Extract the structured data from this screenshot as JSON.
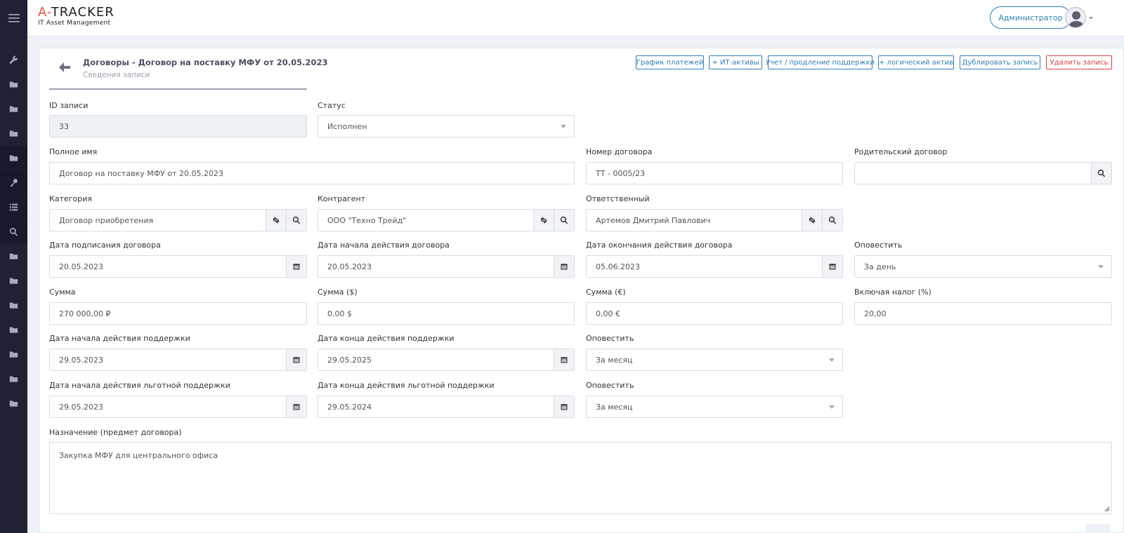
{
  "app": {
    "logo_main_prefix": "A-",
    "logo_main_rest": "TRACKER",
    "logo_sub": "IT Asset Management",
    "user_button": "Администратор"
  },
  "sidebar": {
    "items": [
      "menu-icon",
      "wrench-icon",
      "folder-icon",
      "folder-icon",
      "folder-icon",
      "folder-icon",
      "key-icon",
      "list-icon",
      "search-icon",
      "folder-icon",
      "folder-icon",
      "folder-icon",
      "folder-icon",
      "folder-icon",
      "folder-icon",
      "folder-icon"
    ]
  },
  "record": {
    "title": "Договоры - Договор на поставку МФУ от 20.05.2023",
    "subtitle": "Сведения записи"
  },
  "toolbar": {
    "payments": "График платежей",
    "it_assets": "+ ИТ-активы",
    "support": "Учет / продление поддержки",
    "logical_asset": "+ логический актив",
    "duplicate": "Дублировать запись",
    "delete": "Удалить запись"
  },
  "form": {
    "record_id": {
      "label": "ID записи",
      "value": "33"
    },
    "status": {
      "label": "Статус",
      "value": "Исполнен"
    },
    "full_name": {
      "label": "Полное имя",
      "value": "Договор на поставку МФУ от 20.05.2023"
    },
    "contract_number": {
      "label": "Номер договора",
      "value": "ТТ - 0005/23"
    },
    "parent_contract": {
      "label": "Родительский договор",
      "value": ""
    },
    "category": {
      "label": "Категория",
      "value": "Договор приобретения"
    },
    "counterparty": {
      "label": "Контрагент",
      "value": "ООО \"Техно Трейд\""
    },
    "responsible": {
      "label": "Ответственный",
      "value": "Артемов Дмитрий Павлович"
    },
    "sign_date": {
      "label": "Дата подписания договора",
      "value": "20.05.2023"
    },
    "start_date": {
      "label": "Дата начала действия договора",
      "value": "20.05.2023"
    },
    "end_date": {
      "label": "Дата окончания действия договора",
      "value": "05.06.2023"
    },
    "notify_1": {
      "label": "Оповестить",
      "value": "За день"
    },
    "sum_rub": {
      "label": "Сумма",
      "value": "270 000,00 ₽"
    },
    "sum_usd": {
      "label": "Сумма ($)",
      "value": "0,00 $"
    },
    "sum_eur": {
      "label": "Сумма (€)",
      "value": "0,00 €"
    },
    "tax": {
      "label": "Включая налог (%)",
      "value": "20,00"
    },
    "support_start": {
      "label": "Дата начала действия поддержки",
      "value": "29.05.2023"
    },
    "support_end": {
      "label": "Дата конца действия поддержки",
      "value": "29.05.2025"
    },
    "notify_2": {
      "label": "Оповестить",
      "value": "За месяц"
    },
    "grace_start": {
      "label": "Дата начала действия льготной поддержки",
      "value": "29.05.2023"
    },
    "grace_end": {
      "label": "Дата конца действия льготной поддержки",
      "value": "29.05.2024"
    },
    "notify_3": {
      "label": "Оповестить",
      "value": "За месяц"
    },
    "purpose": {
      "label": "Назначение (предмет договора)",
      "value": "Закупка МФУ для центрального офиса"
    }
  }
}
